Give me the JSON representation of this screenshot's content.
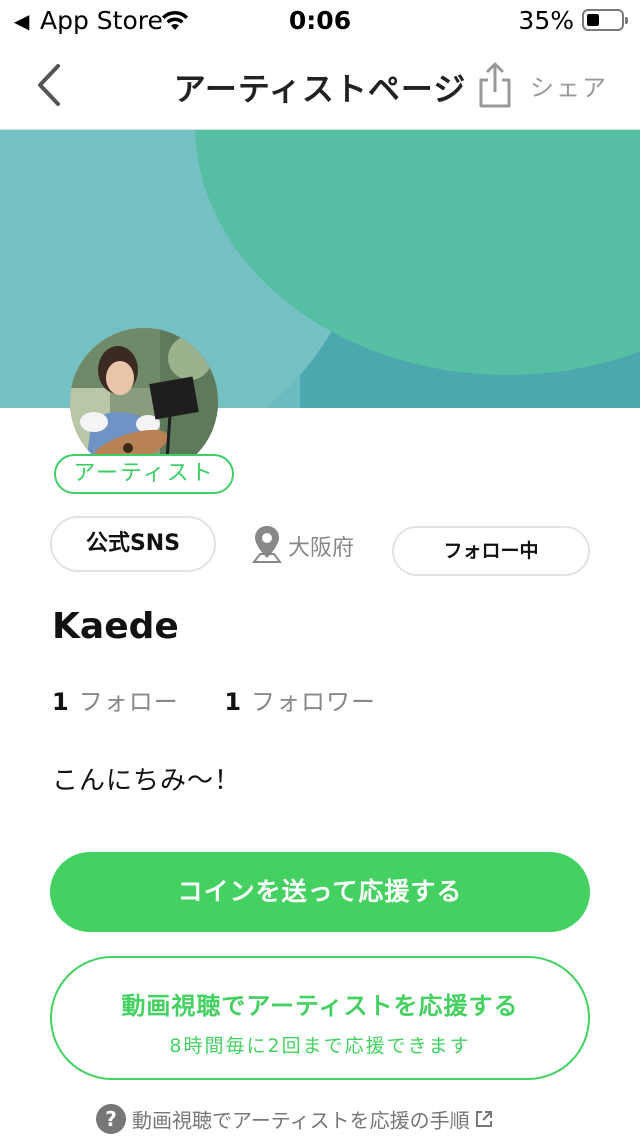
{
  "status_bar": {
    "back_app": "App Store",
    "time": "0:06",
    "battery": "35%"
  },
  "nav": {
    "title": "アーティストページ",
    "share_label": "シェア"
  },
  "profile": {
    "badge": "アーティスト",
    "sns_button": "公式SNS",
    "location": "大阪府",
    "follow_button": "フォロー中",
    "name": "Kaede",
    "following_count": "1",
    "following_label": "フォロー",
    "followers_count": "1",
    "followers_label": "フォロワー",
    "bio": "こんにちみ〜！"
  },
  "actions": {
    "coin_button": "コインを送って応援する",
    "video_button_title": "動画視聴でアーティストを応援する",
    "video_button_sub": "8時間毎に2回まで応援できます",
    "help_link": "動画視聴でアーティストを応援の手順"
  },
  "colors": {
    "accent_green": "#45d162",
    "banner_teal": "#6bbcbe",
    "banner_green": "#56bea2"
  }
}
